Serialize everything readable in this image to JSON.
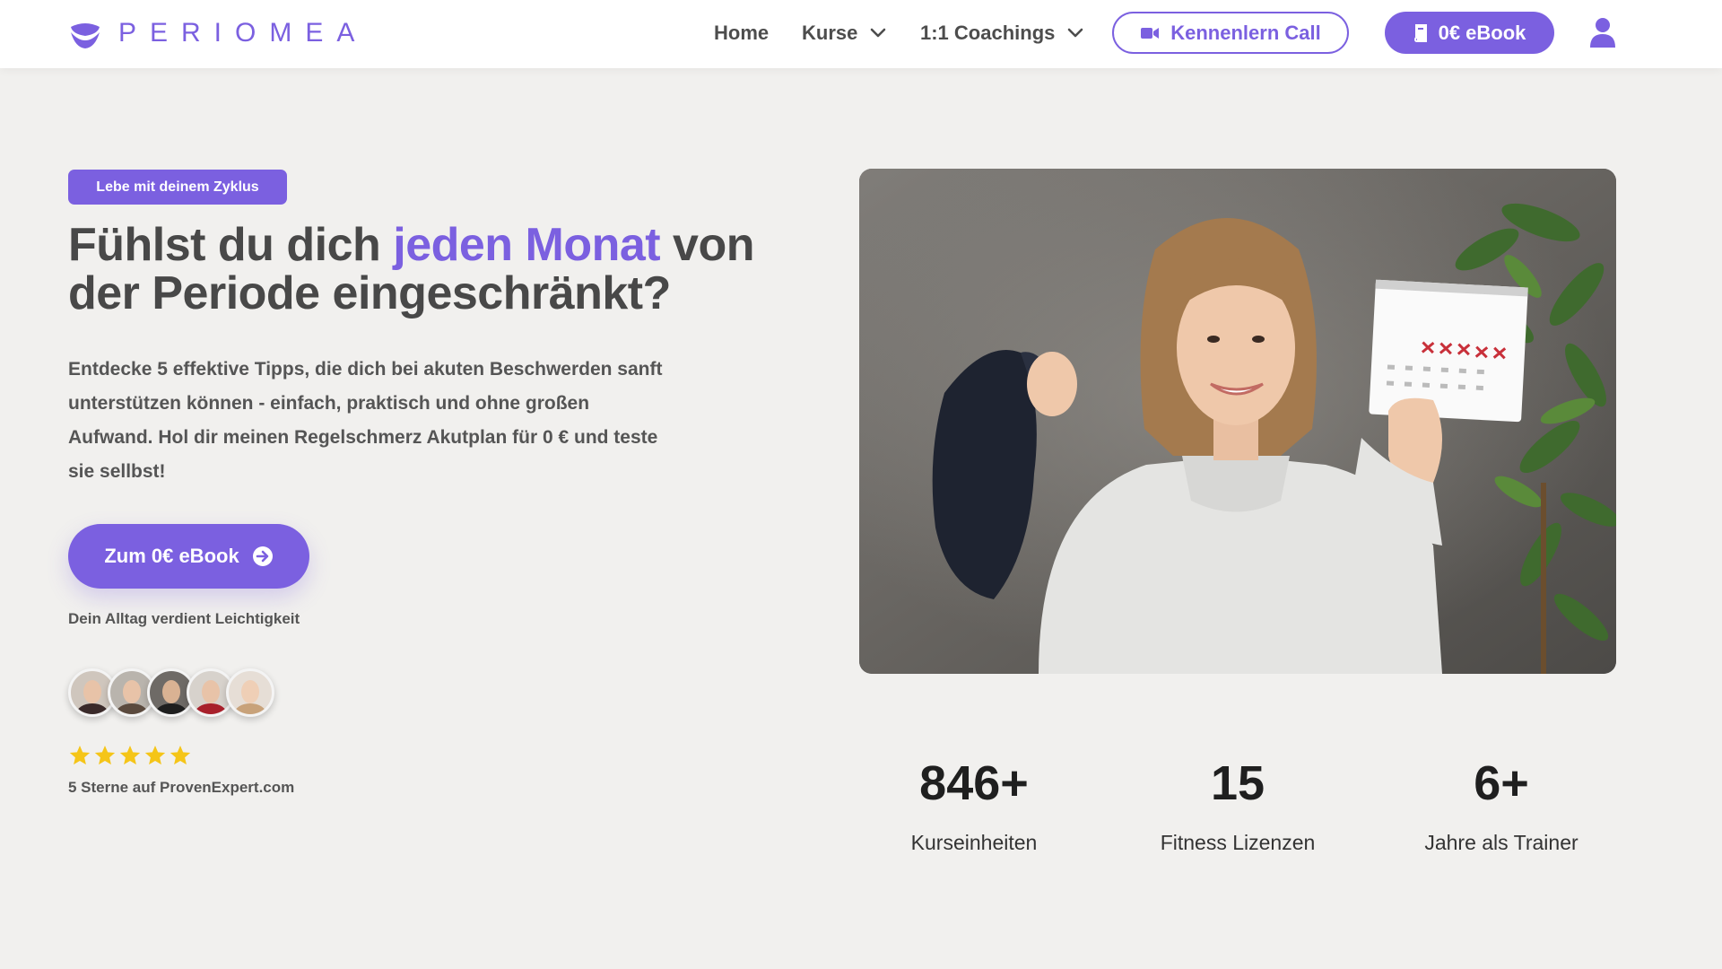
{
  "header": {
    "brand": "PERIOMEA",
    "nav": [
      {
        "label": "Home"
      },
      {
        "label": "Kurse"
      },
      {
        "label": "1:1 Coachings"
      }
    ],
    "call_button": "Kennenlern Call",
    "ebook_button": "0€ eBook",
    "icons": {
      "call": "video-camera-icon",
      "ebook": "book-icon",
      "account": "user-icon",
      "dropdown": "chevron-down-icon"
    }
  },
  "hero": {
    "tag": "Lebe mit deinem Zyklus",
    "headline_part1": "Fühlst du dich ",
    "headline_accent": "jeden Monat",
    "headline_part2": " von der Periode eingeschränkt?",
    "lead": "Entdecke 5 effektive Tipps, die dich bei akuten Beschwerden sanft unterstützen können - einfach, praktisch und ohne großen Aufwand. Hol dir meinen Regelschmerz Akutplan für 0 € und teste sie sellbst!",
    "cta": "Zum 0€ eBook",
    "cta_sub": "Dein Alltag verdient Leichtigkeit",
    "rating": 5,
    "rating_text": "5 Sterne auf ProvenExpert.com"
  },
  "stats": [
    {
      "value": "846+",
      "label": "Kurseinheiten"
    },
    {
      "value": "15",
      "label": "Fitness Lizenzen"
    },
    {
      "value": "6+",
      "label": "Jahre als Trainer"
    }
  ],
  "colors": {
    "accent": "#7b60e0",
    "background": "#f1f0ee",
    "star": "#f5c518"
  }
}
